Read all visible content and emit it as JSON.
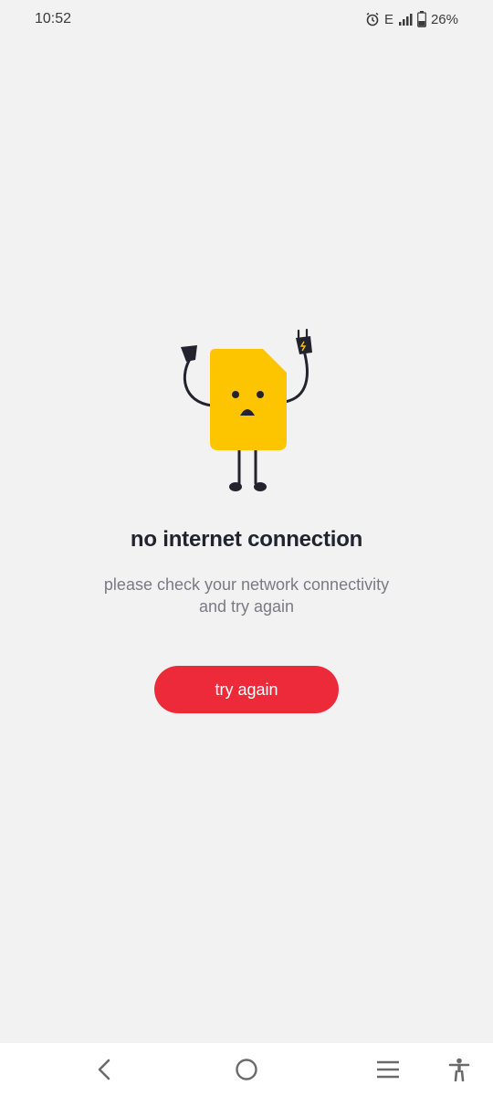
{
  "status_bar": {
    "time": "10:52",
    "network": "E",
    "battery": "26%",
    "icons": [
      "alarm-icon",
      "signal-icon",
      "battery-icon"
    ]
  },
  "error": {
    "title": "no internet connection",
    "message_line1": "please check your network connectivity",
    "message_line2": "and try again",
    "button_label": "try again"
  },
  "nav_bar": {
    "icons": [
      "back-icon",
      "home-icon",
      "recents-icon",
      "accessibility-icon"
    ]
  },
  "colors": {
    "background": "#f2f2f2",
    "accent": "#ed2a3a",
    "sim_card": "#fdc500",
    "title": "#23232f",
    "message": "#7a7a84"
  }
}
